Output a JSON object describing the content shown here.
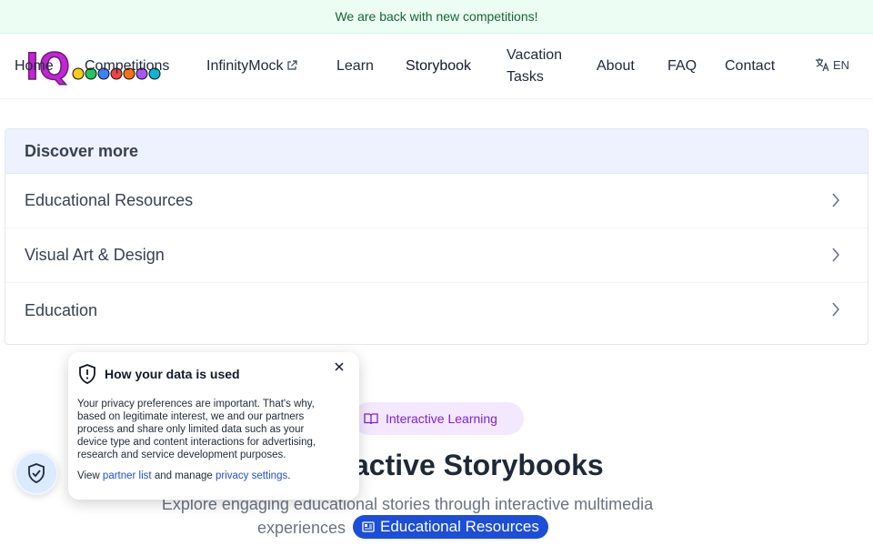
{
  "banner": {
    "text": "We are back with new competitions!"
  },
  "nav": {
    "logo_text": "IQ",
    "items": [
      {
        "label": "Home"
      },
      {
        "label": "Competitions"
      },
      {
        "label": "InfinityMock"
      },
      {
        "label": "Learn"
      },
      {
        "label": "Storybook"
      },
      {
        "label": "Vacation"
      },
      {
        "label": "Tasks"
      },
      {
        "label": "About"
      },
      {
        "label": "FAQ"
      },
      {
        "label": "Contact"
      }
    ],
    "lang": "EN"
  },
  "discover": {
    "title": "Discover more",
    "items": [
      {
        "label": "Educational Resources"
      },
      {
        "label": "Visual Art & Design"
      },
      {
        "label": "Education"
      }
    ]
  },
  "hero": {
    "badge": "Interactive Learning",
    "title_visible": "active Storybooks",
    "subtitle_line1": "Explore engaging educational stories through interactive multimedia",
    "subtitle_line2": "experiences",
    "edu_pill": "Educational Resources"
  },
  "privacy": {
    "title": "How your data is used",
    "body": "Your privacy preferences are important. That's why, based on legitimate interest, we and our partners process and share only limited data such as your device type and content interactions for advertising, research and service development purposes.",
    "foot_prefix": "View",
    "partner_link": "partner list",
    "foot_middle": "and manage",
    "settings_link": "privacy settings",
    "foot_suffix": "."
  },
  "colors": {
    "banner_bg": "#ecfdf3",
    "banner_text": "#166534",
    "discover_header_bg": "#eef2ff",
    "badge_bg": "#f3e8ff",
    "badge_text": "#7e22ce",
    "edu_pill_bg": "#1d4ed8",
    "link": "#1d4ed8"
  }
}
